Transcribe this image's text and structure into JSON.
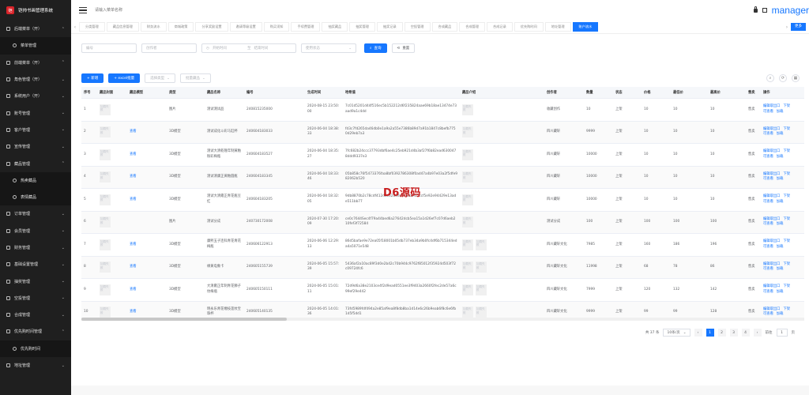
{
  "app": {
    "title": "铠帅书画管理系统",
    "logo_text": "铠"
  },
  "sidebar": {
    "items": [
      {
        "label": "后端菜单（开）",
        "arrow": "⌃",
        "sub": false
      },
      {
        "label": "菜单管理",
        "sub": true
      },
      {
        "label": "前端菜单（开）",
        "arrow": "⌃",
        "sub": false
      },
      {
        "label": "角色管理（开）",
        "arrow": "⌄",
        "sub": false
      },
      {
        "label": "系统用户（开）",
        "arrow": "⌄",
        "sub": false
      },
      {
        "label": "账号管理",
        "arrow": "⌄",
        "sub": false
      },
      {
        "label": "客户管理",
        "arrow": "⌄",
        "sub": false
      },
      {
        "label": "宣传管理",
        "arrow": "⌄",
        "sub": false
      },
      {
        "label": "藏品管理",
        "arrow": "⌃",
        "sub": false
      },
      {
        "label": "热卖藏品",
        "sub": true
      },
      {
        "label": "表情藏品",
        "sub": true
      },
      {
        "label": "订单管理",
        "arrow": "⌄",
        "sub": false
      },
      {
        "label": "会员管理",
        "arrow": "⌄",
        "sub": false
      },
      {
        "label": "财务管理",
        "arrow": "⌄",
        "sub": false
      },
      {
        "label": "基础设置管理",
        "arrow": "⌄",
        "sub": false
      },
      {
        "label": "抽奖管理",
        "arrow": "⌄",
        "sub": false
      },
      {
        "label": "空投管理",
        "arrow": "⌄",
        "sub": false
      },
      {
        "label": "合成管理",
        "arrow": "⌄",
        "sub": false
      },
      {
        "label": "优先购时间管理",
        "arrow": "⌃",
        "sub": false
      },
      {
        "label": "优先购时间",
        "sub": true
      },
      {
        "label": "地址管理",
        "arrow": "⌄",
        "sub": false
      }
    ]
  },
  "header": {
    "search_placeholder": "请输入菜单名称",
    "user": "manager"
  },
  "tabs": [
    "分类管理",
    "藏品信息管理",
    "财务流水",
    "商城政策",
    "分享奖励设置",
    "邀请等级设置",
    "购买须知",
    "手续费管理",
    "抽奖藏品",
    "抽奖管理",
    "抽奖记录",
    "空投管理",
    "合成藏品",
    "合成管理",
    "合成记录",
    "优先购时间",
    "地址管理",
    "账户流水"
  ],
  "tabs_more": "更多",
  "search": {
    "no_placeholder": "编号",
    "creator_placeholder": "创作者",
    "start_placeholder": "开始时间",
    "sep": "至",
    "end_placeholder": "结束时间",
    "status_placeholder": "使用状态",
    "search_label": "查询",
    "reset_label": "重置"
  },
  "toolbar": {
    "add_label": "+ 新增",
    "import_label": "+ excel批量",
    "type_select": "选择类型",
    "batch_select": "批量藏品"
  },
  "table": {
    "columns": [
      "序号",
      "藏品封面",
      "藏品模型",
      "类型",
      "藏品名称",
      "编号",
      "生成时间",
      "哈希值",
      "藏品介绍",
      "创作者",
      "数量",
      "状态",
      "价格",
      "最低价",
      "最高价",
      "售卖",
      "操作"
    ],
    "thumb_text": "加载失败",
    "rows": [
      {
        "idx": "1",
        "model": "",
        "type": "图片",
        "name": "测试测试品",
        "no": "240815235000",
        "time": "2024-08-15 23:50:00",
        "hash": "7c01d5201d44f516ec5b152212d6f235824aae69b18ae13474e73aad9a1c4dd",
        "intro_thumbs": 1,
        "creator": "收藏创作",
        "qty": "10",
        "status": "上架",
        "price": "10",
        "min": "10",
        "max": "10",
        "sale": "售卖"
      },
      {
        "idx": "2",
        "model": "查看",
        "type": "3D模型",
        "name": "测试成化斗彩马缸杯",
        "no": "240604183033",
        "time": "2024-06-04 18:38:33",
        "hash": "fd3c7fd265da46db0e1a9a2a55e7386b89d7a91b1847c8befb7750d29eb7a3",
        "intro_thumbs": 1,
        "creator": "四川藏轩",
        "qty": "9999",
        "status": "上架",
        "price": "10",
        "min": "10",
        "max": "10",
        "sale": "售卖"
      },
      {
        "idx": "3",
        "model": "查看",
        "type": "3D模型",
        "name": "测试大清乾隆年制黄釉粉彩梅瓶",
        "no": "240604183527",
        "time": "2024-06-04 18:35:27",
        "hash": "7fc682b24ccc37793dbf6ae4c25eb921d4b3af27f6b82ead6300478ddd9337e3",
        "intro_thumbs": 1,
        "creator": "四川藏轩",
        "qty": "10000",
        "status": "上架",
        "price": "10",
        "min": "10",
        "max": "10",
        "sale": "售卖"
      },
      {
        "idx": "4",
        "model": "查看",
        "type": "3D模型",
        "name": "测试清康正黄釉圆瓶",
        "no": "240604183345",
        "time": "2024-06-04 18:33:46",
        "hash": "05b858c76f5473376faa8bf0392786308f0ad47a4b97e03a2f5dfe982062b520",
        "intro_thumbs": 1,
        "creator": "四川藏轩",
        "qty": "10000",
        "status": "上架",
        "price": "10",
        "min": "10",
        "max": "10",
        "sale": "售卖"
      },
      {
        "idx": "5",
        "model": "查看",
        "type": "3D模型",
        "name": "测试大清雍正青花瓶豆红",
        "no": "240604183205",
        "time": "2024-06-04 18:32:05",
        "hash": "9db8870b2c78cdf412d5c62a0de5e6fb2f05ccf5e92e94429e13ade511bb77",
        "intro_thumbs": 1,
        "creator": "四川藏轩",
        "qty": "10000",
        "status": "上架",
        "price": "10",
        "min": "10",
        "max": "10",
        "sale": "售卖"
      },
      {
        "idx": "6",
        "model": "",
        "type": "图片",
        "name": "测试分成",
        "no": "240730172008",
        "time": "2024-07-30 17:20:09",
        "hash": "ce0c7644Sec4f79a44bed6a27642dcb5ea15a1d26ef7c07d6aeb210fef3f72584",
        "intro_thumbs": 1,
        "creator": "测试分成",
        "qty": "100",
        "status": "上架",
        "price": "100",
        "min": "100",
        "max": "100",
        "sale": "售卖"
      },
      {
        "idx": "7",
        "model": "查看",
        "type": "3D模型",
        "name": "康熙五子连科青花青花梅瓶",
        "no": "240606122913",
        "time": "2024-06-06 12:29:13",
        "hash": "86d5bafae9e72ea05f18001b05db737eb34a9b0fc4df6b715344eda4a5071e548",
        "intro_thumbs": 2,
        "creator": "四川藏轩文化",
        "qty": "7985",
        "status": "上架",
        "price": "160",
        "min": "186",
        "max": "196",
        "sale": "售卖"
      },
      {
        "idx": "8",
        "model": "查看",
        "type": "3D模型",
        "name": "缘黄电象卡",
        "no": "240605155739",
        "time": "2024-06-05 15:57:39",
        "hash": "5436af2a10ac89f3d0e2b42c70b944c9762f85012f35924d503f72c09724fc6",
        "intro_thumbs": 2,
        "creator": "四川藏轩文化",
        "qty": "11998",
        "status": "上架",
        "price": "68",
        "min": "78",
        "max": "86",
        "sale": "售卖"
      },
      {
        "idx": "9",
        "model": "查看",
        "type": "3D模型",
        "name": "大清雍正年制青花狮子纹梅瓶",
        "no": "240605150111",
        "time": "2024-06-05 15:01:11",
        "hash": "72d9d6a38e2103ce4f2d9ead0551ee3f9403a2660f2fec2de57a6c99ef29e442",
        "intro_thumbs": 2,
        "creator": "四川藏轩文化",
        "qty": "7999",
        "status": "上架",
        "price": "120",
        "min": "132",
        "max": "142",
        "sale": "售卖"
      },
      {
        "idx": "10",
        "model": "查看",
        "type": "3D模型",
        "name": "明永乐青花缠枝莲纹宝珠杯",
        "no": "240605140135",
        "time": "2024-06-05 14:01:36",
        "hash": "73fd5989fdf494a2e85af9ea8f8db8ba1d14e6c26b9eab6f8c6e6fb1d5f5dd1",
        "intro_thumbs": 2,
        "creator": "四川藏轩文化",
        "qty": "9999",
        "status": "上架",
        "price": "99",
        "min": "99",
        "max": "128",
        "sale": "售卖"
      }
    ],
    "ops": {
      "edit": "编辑取出口",
      "down": "下架",
      "check": "可查看",
      "add": "加载"
    }
  },
  "watermark": "D6源码",
  "pagination": {
    "total": "共 37 条",
    "size": "10条/页",
    "pages": [
      "1",
      "2",
      "3",
      "4"
    ],
    "prev": "‹",
    "next": "›",
    "goto_label": "前往",
    "goto_value": "1",
    "page_unit": "页"
  }
}
